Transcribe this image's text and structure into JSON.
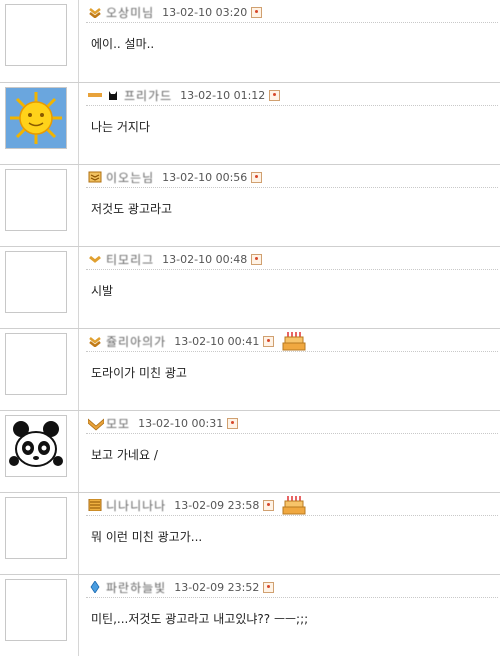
{
  "comments": [
    {
      "nick": "오상미님",
      "time": "13-02-10 03:20",
      "text": "에이.. 설마..",
      "level_icon": "double-chevron-badge-icon",
      "avatar": "blank-avatar",
      "cake": false
    },
    {
      "nick": "프리가드",
      "time": "13-02-10 01:12",
      "text": "나는 거지다",
      "level_icon": "bar-badge-icon",
      "avatar": "sun-face-avatar",
      "cake": false
    },
    {
      "nick": "이오는님",
      "time": "13-02-10 00:56",
      "text": "저것도 광고라고",
      "level_icon": "stacked-chevron-badge-icon",
      "avatar": "blank-avatar",
      "cake": false
    },
    {
      "nick": "티모리그",
      "time": "13-02-10 00:48",
      "text": "시발",
      "level_icon": "single-chevron-badge-icon",
      "avatar": "blank-avatar",
      "cake": false
    },
    {
      "nick": "쥴리아의가",
      "time": "13-02-10 00:41",
      "text": "도라이가 미친 광고",
      "level_icon": "double-chevron-badge-icon",
      "avatar": "blank-avatar",
      "cake": true
    },
    {
      "nick": "모모",
      "time": "13-02-10 00:31",
      "text": "보고 가네요 /",
      "level_icon": "wing-chevron-badge-icon",
      "avatar": "panda-avatar",
      "cake": false
    },
    {
      "nick": "니나니나나",
      "time": "13-02-09 23:58",
      "text": "뭐 이런 미친 광고가...",
      "level_icon": "striped-box-badge-icon",
      "avatar": "blank-avatar",
      "cake": true
    },
    {
      "nick": "파란하늘빛",
      "time": "13-02-09 23:52",
      "text": "미틴,...저것도 광고라고 내고있냐?? ㅡㅡ;;;",
      "level_icon": "diamond-badge-icon",
      "avatar": "blank-avatar",
      "cake": false
    }
  ],
  "colors": {
    "accent": "#e8a23a",
    "border": "#cfcfcf",
    "profile_icon": "#d7482b"
  }
}
